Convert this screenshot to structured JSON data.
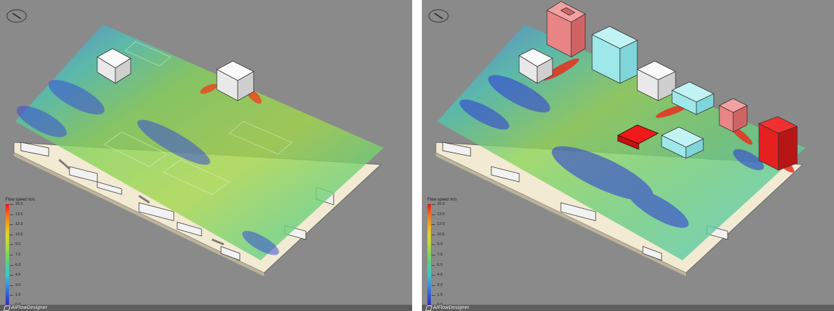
{
  "panels": [
    {
      "id": "before",
      "legend": {
        "title": "Flow speed m/s",
        "ticks": [
          "15.0",
          "13.5",
          "12.0",
          "10.5",
          "9.0",
          "7.5",
          "6.0",
          "4.5",
          "3.0",
          "1.5",
          "0.0"
        ]
      },
      "brand": {
        "prefix": "AI",
        "name": "FlowDesigner"
      }
    },
    {
      "id": "after",
      "legend": {
        "title": "Flow speed m/s",
        "ticks": [
          "15.0",
          "13.5",
          "12.0",
          "10.5",
          "9.0",
          "7.5",
          "6.0",
          "4.5",
          "3.0",
          "1.5",
          "0.0"
        ]
      },
      "brand": {
        "prefix": "AI",
        "name": "FlowDesigner"
      }
    }
  ],
  "colors": {
    "background": "#8a8a8a",
    "ground": "#f3ead3",
    "speed_low": "#2a2fb5",
    "speed_mid": "#7fd65b",
    "speed_high": "#e8141c",
    "building_white": "#eeeeee",
    "building_red": "#e36a6a",
    "building_cyan": "#9fe8ea"
  }
}
